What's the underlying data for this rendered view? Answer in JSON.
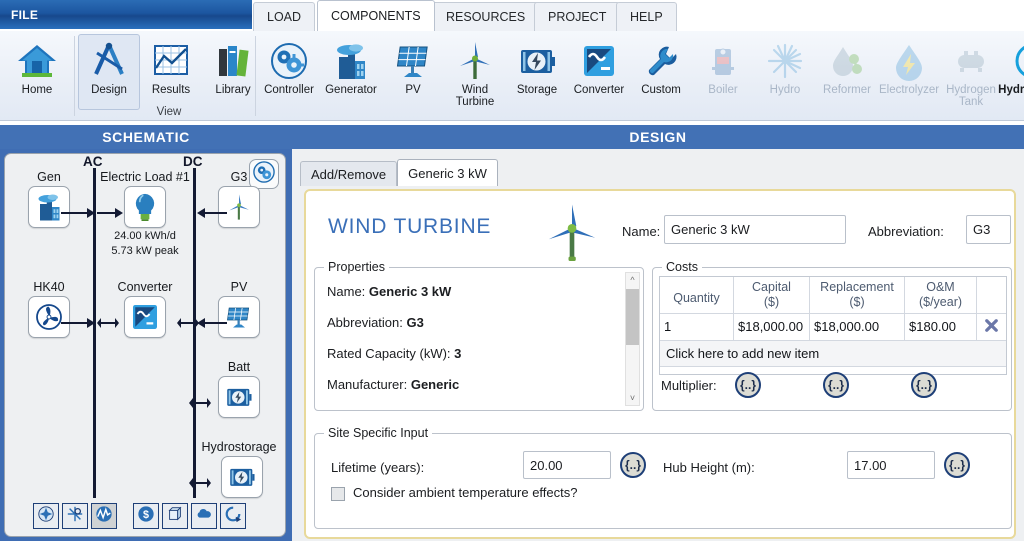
{
  "window": {
    "file_menu": "FILE"
  },
  "ribbon": {
    "tabs": [
      {
        "label": "LOAD",
        "active": false
      },
      {
        "label": "COMPONENTS",
        "active": true
      },
      {
        "label": "RESOURCES",
        "active": false
      },
      {
        "label": "PROJECT",
        "active": false
      },
      {
        "label": "HELP",
        "active": false
      }
    ],
    "view_group": {
      "label": "View",
      "buttons": [
        {
          "label": "Home",
          "icon": "home-icon",
          "selected": false,
          "enabled": true
        },
        {
          "label": "Design",
          "icon": "compass-icon",
          "selected": true,
          "enabled": true
        },
        {
          "label": "Results",
          "icon": "chart-grid-icon",
          "selected": false,
          "enabled": true
        },
        {
          "label": "Library",
          "icon": "books-icon",
          "selected": false,
          "enabled": true
        }
      ]
    },
    "components_group": {
      "buttons": [
        {
          "label": "Controller",
          "icon": "controller-gear-icon",
          "enabled": true
        },
        {
          "label": "Generator",
          "icon": "generator-icon",
          "enabled": true
        },
        {
          "label": "PV",
          "icon": "solar-panel-icon",
          "enabled": true
        },
        {
          "label": "Wind Turbine",
          "icon": "wind-turbine-icon",
          "enabled": true
        },
        {
          "label": "Storage",
          "icon": "battery-storage-icon",
          "enabled": true
        },
        {
          "label": "Converter",
          "icon": "converter-icon",
          "enabled": true
        },
        {
          "label": "Custom",
          "icon": "wrench-icon",
          "enabled": true
        },
        {
          "label": "Boiler",
          "icon": "boiler-icon",
          "enabled": false
        },
        {
          "label": "Hydro",
          "icon": "hydro-burst-icon",
          "enabled": false
        },
        {
          "label": "Reformer",
          "icon": "reformer-icon",
          "enabled": false
        },
        {
          "label": "Electrolyzer",
          "icon": "electrolyzer-icon",
          "enabled": false
        },
        {
          "label": "Hydrogen Tank",
          "icon": "hydrogen-tank-icon",
          "enabled": false
        },
        {
          "label": "Hydrokinetic",
          "icon": "hydrokinetic-icon",
          "enabled": true,
          "bold": true
        }
      ]
    }
  },
  "schematic": {
    "header": "SCHEMATIC",
    "bus_labels": {
      "ac": "AC",
      "dc": "DC"
    },
    "nodes": [
      {
        "name": "Gen",
        "icon": "generator-icon"
      },
      {
        "name": "Electric Load #1",
        "icon": "lightbulb-icon",
        "sub_line1": "24.00 kWh/d",
        "sub_line2": "5.73 kW peak"
      },
      {
        "name": "G3",
        "icon": "wind-turbine-icon"
      },
      {
        "name": "HK40",
        "icon": "hydrokinetic-icon"
      },
      {
        "name": "Converter",
        "icon": "converter-icon"
      },
      {
        "name": "PV",
        "icon": "solar-panel-icon"
      },
      {
        "name": "Batt",
        "icon": "battery-storage-icon"
      },
      {
        "name": "Hydrostorage",
        "icon": "battery-storage-icon"
      }
    ],
    "settings_icon": "schematic-settings-gear-icon",
    "toolbar": [
      {
        "icon": "move-icon",
        "active": false
      },
      {
        "icon": "cut-links-icon",
        "active": false
      },
      {
        "icon": "waveform-icon",
        "active": true
      },
      {
        "icon": "dollar-icon",
        "active": false
      },
      {
        "icon": "cube-icon",
        "active": false
      },
      {
        "icon": "cloud-icon",
        "active": false
      },
      {
        "icon": "refresh-icon",
        "active": false
      }
    ]
  },
  "design": {
    "header": "DESIGN",
    "subtabs": [
      {
        "label": "Add/Remove",
        "active": false
      },
      {
        "label": "Generic 3 kW",
        "active": true
      }
    ],
    "card": {
      "title": "WIND TURBINE",
      "icon": "wind-turbine-icon",
      "name_label": "Name:",
      "name_value": "Generic 3 kW",
      "abbrev_label": "Abbreviation:",
      "abbrev_value": "G3"
    },
    "properties": {
      "title": "Properties",
      "rows": [
        {
          "label": "Name:",
          "value": "Generic 3 kW"
        },
        {
          "label": "Abbreviation:",
          "value": "G3"
        },
        {
          "label": "Rated Capacity (kW):",
          "value": "3"
        },
        {
          "label": "Manufacturer:",
          "value": "Generic"
        }
      ]
    },
    "costs": {
      "title": "Costs",
      "columns": [
        "Quantity",
        "Capital ($)",
        "Replacement ($)",
        "O&M ($/year)",
        ""
      ],
      "columns_lines": [
        [
          "Quantity",
          ""
        ],
        [
          "Capital",
          "($)"
        ],
        [
          "Replacement",
          "($)"
        ],
        [
          "O&M",
          "($/year)"
        ],
        [
          "",
          ""
        ]
      ],
      "rows": [
        {
          "quantity": "1",
          "capital": "$18,000.00",
          "replacement": "$18,000.00",
          "om": "$180.00",
          "delete_icon": "delete-x-icon"
        }
      ],
      "add_row_label": "Click here to add new item",
      "multiplier_label": "Multiplier:",
      "multiplier_buttons": [
        "{..}",
        "{..}",
        "{..}"
      ]
    },
    "site_specific": {
      "title": "Site Specific Input",
      "lifetime_label": "Lifetime (years):",
      "lifetime_value": "20.00",
      "lifetime_button": "{..}",
      "hub_height_label": "Hub Height (m):",
      "hub_height_value": "17.00",
      "hub_height_button": "{..}",
      "temperature_checkbox_label": "Consider ambient temperature effects?",
      "temperature_checked": false
    }
  },
  "colors": {
    "accent_blue": "#4271b5",
    "file_tab_blue": "#1c56a0",
    "title_blue": "#3a6fb8",
    "card_border": "#e8d99a",
    "panel_bg": "#eef0f2"
  }
}
